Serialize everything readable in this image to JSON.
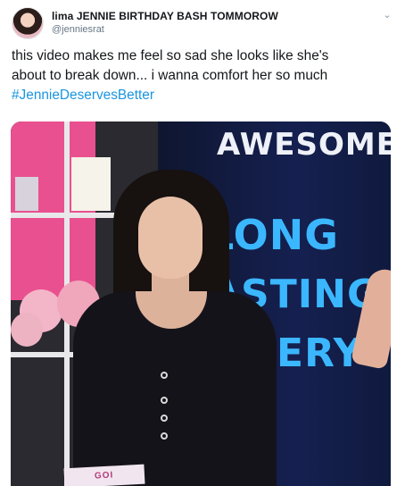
{
  "tweet": {
    "display_name": "lima JENNIE BIRTHDAY BASH TOMMOROW",
    "handle": "@jenniesrat",
    "text_line1": "this video makes me feel so sad she looks like she's",
    "text_line2": "about to break down... i wanna comfort her so much",
    "hashtag": "#JennieDeservesBetter",
    "hashtag_color": "#1b95e0"
  },
  "media": {
    "board_lines": [
      "AWESOME",
      "LONG",
      "ASTING",
      "TTERY"
    ],
    "paper_text": "GOI"
  },
  "icons": {
    "more": "chevron-down-icon",
    "avatar": "avatar"
  }
}
